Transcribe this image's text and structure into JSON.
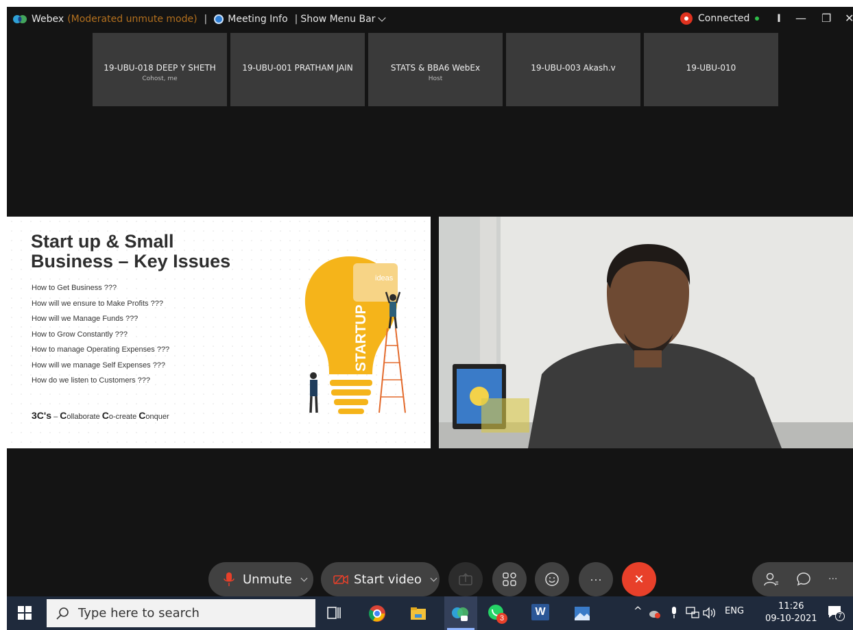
{
  "titlebar": {
    "app_name": "Webex",
    "mode": "(Moderated unmute mode)",
    "separator": "|",
    "meeting_info": "Meeting Info",
    "separator2": "|",
    "show_menu_bar": "Show Menu Bar",
    "connection_status": "Connected",
    "divider": "I",
    "minimize_glyph": "—",
    "restore_glyph": "❐",
    "close_glyph": "✕"
  },
  "participants": [
    {
      "name": "19-UBU-018 DEEP Y SHETH",
      "role": "Cohost, me"
    },
    {
      "name": "19-UBU-001 PRATHAM JAIN",
      "role": ""
    },
    {
      "name": "STATS & BBA6 WebEx",
      "role": "Host"
    },
    {
      "name": "19-UBU-003 Akash.v",
      "role": ""
    },
    {
      "name": "19-UBU-010",
      "role": ""
    }
  ],
  "slide": {
    "title_line1": "Start up & Small",
    "title_line2": "Business – Key Issues",
    "items": [
      "How to Get Business ???",
      "How will we ensure to Make Profits ???",
      "How will we Manage Funds ???",
      "How to Grow Constantly ???",
      "How to manage Operating Expenses ???",
      "How will we manage Self Expenses ???",
      "How do we listen to Customers ???"
    ],
    "footer_lead": "3C's",
    "footer_dash": " – ",
    "footer_words": [
      {
        "initial": "C",
        "rest": "ollaborate "
      },
      {
        "initial": "C",
        "rest": "o-create "
      },
      {
        "initial": "C",
        "rest": "onquer"
      }
    ],
    "bulb_word": "STARTUP",
    "puzzle_word": "ideas"
  },
  "controls": {
    "unmute_label": "Unmute",
    "start_video_label": "Start video",
    "more_glyph": "···",
    "end_glyph": "✕"
  },
  "taskbar": {
    "search_placeholder": "Type here to search",
    "whatsapp_badge": "3",
    "word_letter": "W",
    "language": "ENG",
    "time": "11:26",
    "date": "09-10-2021",
    "notification_count": "7"
  },
  "colors": {
    "accent_orange": "#b3701e",
    "end_call_red": "#e8402a",
    "recording_red": "#e0321f",
    "connected_green": "#2fbf4a",
    "bulb_yellow": "#f5b41a"
  }
}
